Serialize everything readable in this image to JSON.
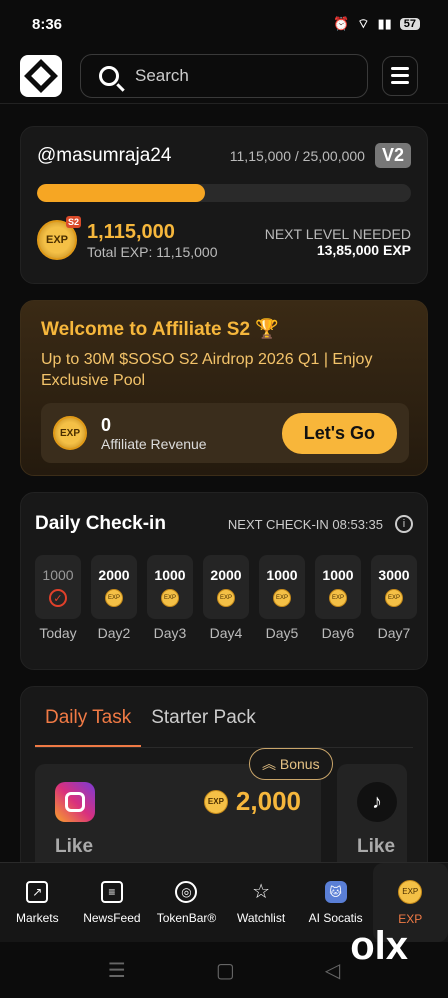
{
  "status": {
    "time": "8:36",
    "battery": "57"
  },
  "header": {
    "search_placeholder": "Search"
  },
  "profile": {
    "username": "@masumraja24",
    "progress_text": "11,15,000 / 25,00,000",
    "version": "V2",
    "progress": 0.45,
    "exp_value": "1,115,000",
    "total_exp": "Total EXP: 11,15,000",
    "next_label": "NEXT LEVEL NEEDED",
    "next_value": "13,85,000 EXP",
    "coin_label": "EXP",
    "coin_badge": "S2"
  },
  "affiliate": {
    "title": "Welcome to Affiliate S2 🏆",
    "subtitle": "Up to 30M $SOSO S2 Airdrop 2026 Q1 | Enjoy Exclusive Pool",
    "revenue_value": "0",
    "revenue_label": "Affiliate Revenue",
    "button": "Let's Go"
  },
  "checkin": {
    "title": "Daily Check-in",
    "next": "NEXT CHECK-IN 08:53:35",
    "days": [
      {
        "value": "1000",
        "label": "Today"
      },
      {
        "value": "2000",
        "label": "Day2"
      },
      {
        "value": "1000",
        "label": "Day3"
      },
      {
        "value": "2000",
        "label": "Day4"
      },
      {
        "value": "1000",
        "label": "Day5"
      },
      {
        "value": "1000",
        "label": "Day6"
      },
      {
        "value": "3000",
        "label": "Day7"
      }
    ]
  },
  "tasks": {
    "tabs": [
      "Daily Task",
      "Starter Pack"
    ],
    "bonus": "Bonus",
    "cards": [
      {
        "label": "Like",
        "reward": "2,000"
      },
      {
        "label": "Like"
      }
    ]
  },
  "bottom_nav": [
    "Markets",
    "NewsFeed",
    "TokenBar®",
    "Watchlist",
    "AI Socatis",
    "EXP"
  ],
  "colors": {
    "accent": "#f07a45",
    "gold": "#f6b73c"
  }
}
